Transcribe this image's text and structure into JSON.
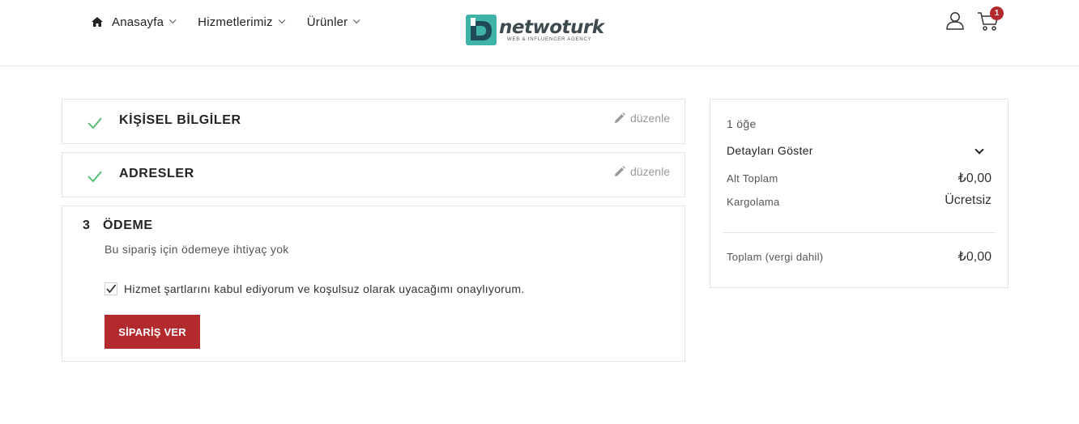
{
  "header": {
    "nav": [
      {
        "label": "Anasayfa",
        "icon": "home-icon"
      },
      {
        "label": "Hizmetlerimiz"
      },
      {
        "label": "Ürünler"
      }
    ],
    "logo": {
      "word": "netwoturk",
      "tagline": "WEB & INFLUENCER AGENCY"
    },
    "cart_count": "1"
  },
  "steps": {
    "personal": {
      "title": "KİŞİSEL BİLGİLER",
      "edit_label": "düzenle",
      "done": true
    },
    "address": {
      "title": "ADRESLER",
      "edit_label": "düzenle",
      "done": true
    },
    "payment": {
      "number": "3",
      "title": "ÖDEME",
      "note": "Bu sipariş için ödemeye ihtiyaç yok",
      "terms_label": "Hizmet şartlarını kabul ediyorum ve koşulsuz olarak uyacağımı onaylıyorum.",
      "terms_checked": true,
      "order_button": "SİPARİŞ VER"
    }
  },
  "summary": {
    "item_count": "1 öğe",
    "show_details": "Detayları Göster",
    "subtotal_label": "Alt Toplam",
    "subtotal_value": "₺0,00",
    "shipping_label": "Kargolama",
    "shipping_value": "Ücretsiz",
    "total_label": "Toplam (vergi dahil)",
    "total_value": "₺0,00"
  },
  "colors": {
    "accent": "#b22a2e",
    "check": "#4cbb6c",
    "logo_teal": "#3fb3a8",
    "logo_dark": "#1f4a5a"
  }
}
